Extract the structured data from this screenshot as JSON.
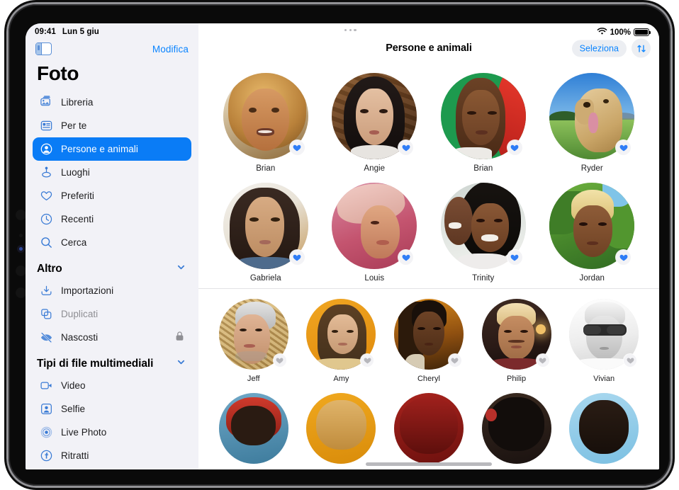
{
  "status_bar": {
    "time": "09:41",
    "date": "Lun 5 giu",
    "battery_percent": "100%",
    "wifi_icon": "wifi-icon",
    "battery_icon": "battery-icon"
  },
  "sidebar": {
    "toggle_icon": "sidebar-toggle-icon",
    "edit_label": "Modifica",
    "app_title": "Foto",
    "primary_items": [
      {
        "label": "Libreria",
        "icon": "photos-library-icon",
        "selected": false,
        "dim": false
      },
      {
        "label": "Per te",
        "icon": "for-you-icon",
        "selected": false,
        "dim": false
      },
      {
        "label": "Persone e animali",
        "icon": "people-pets-icon",
        "selected": true,
        "dim": false
      },
      {
        "label": "Luoghi",
        "icon": "places-pin-icon",
        "selected": false,
        "dim": false
      },
      {
        "label": "Preferiti",
        "icon": "heart-icon",
        "selected": false,
        "dim": false
      },
      {
        "label": "Recenti",
        "icon": "clock-icon",
        "selected": false,
        "dim": false
      },
      {
        "label": "Cerca",
        "icon": "search-icon",
        "selected": false,
        "dim": false
      }
    ],
    "group_other": {
      "title": "Altro",
      "chevron_icon": "chevron-down-icon",
      "items": [
        {
          "label": "Importazioni",
          "icon": "import-icon",
          "dim": false,
          "locked": false
        },
        {
          "label": "Duplicati",
          "icon": "duplicates-icon",
          "dim": true,
          "locked": false
        },
        {
          "label": "Nascosti",
          "icon": "hidden-eye-icon",
          "dim": false,
          "locked": true,
          "lock_icon": "lock-icon"
        }
      ]
    },
    "group_media_types": {
      "title": "Tipi di file multimediali",
      "chevron_icon": "chevron-down-icon",
      "items": [
        {
          "label": "Video",
          "icon": "video-icon"
        },
        {
          "label": "Selfie",
          "icon": "selfie-icon"
        },
        {
          "label": "Live Photo",
          "icon": "live-photo-icon"
        },
        {
          "label": "Ritratti",
          "icon": "portrait-icon"
        }
      ]
    }
  },
  "main": {
    "title": "Persone e animali",
    "select_label": "Seleziona",
    "sort_icon": "sort-arrows-icon",
    "multitask_icon": "multitasking-dots-icon",
    "rows": [
      {
        "columns": 4,
        "people": [
          {
            "name": "Brian",
            "favorite": true
          },
          {
            "name": "Angie",
            "favorite": true
          },
          {
            "name": "Brian",
            "favorite": true
          },
          {
            "name": "Ryder",
            "favorite": true
          }
        ]
      },
      {
        "columns": 4,
        "people": [
          {
            "name": "Gabriela",
            "favorite": true
          },
          {
            "name": "Louis",
            "favorite": true
          },
          {
            "name": "Trinity",
            "favorite": true
          },
          {
            "name": "Jordan",
            "favorite": true
          }
        ]
      },
      {
        "columns": 5,
        "people": [
          {
            "name": "Jeff",
            "favorite": false
          },
          {
            "name": "Amy",
            "favorite": false
          },
          {
            "name": "Cheryl",
            "favorite": false
          },
          {
            "name": "Philip",
            "favorite": false
          },
          {
            "name": "Vivian",
            "favorite": false
          }
        ]
      }
    ]
  },
  "colors": {
    "accent_blue": "#0a84ff",
    "selected_blue": "#0a7cf6",
    "sidebar_bg": "#f2f2f7",
    "favorite_heart": "#2f7df6",
    "inactive_heart": "#b7b7bc"
  },
  "home_indicator": "home-indicator"
}
